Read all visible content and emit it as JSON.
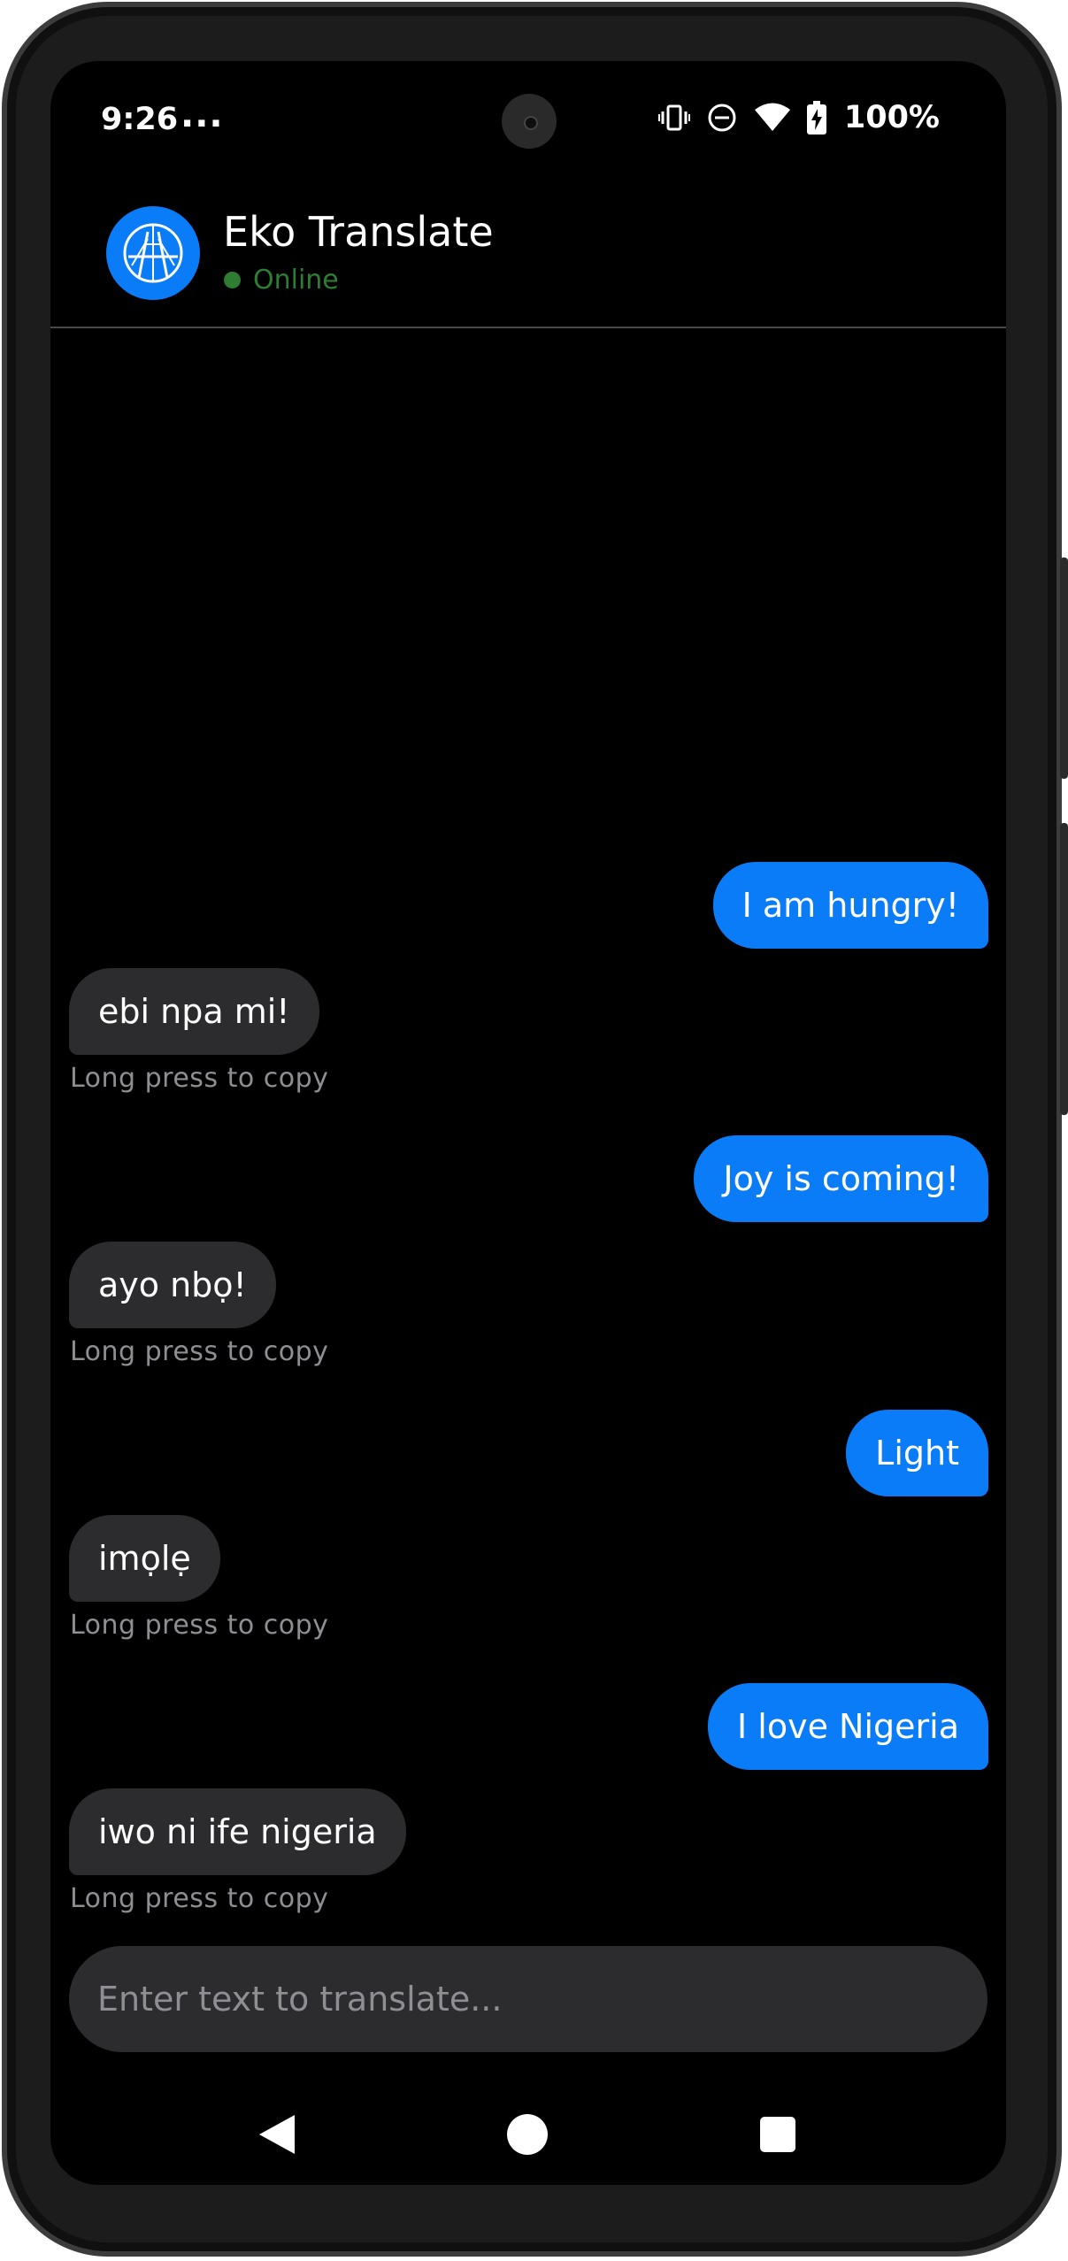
{
  "status_bar": {
    "time": "9:26",
    "overflow": "...",
    "battery": "100%",
    "icons": [
      "vibrate-icon",
      "do-not-disturb-icon",
      "wifi-icon",
      "battery-charging-icon"
    ]
  },
  "header": {
    "app_name": "Eko Translate",
    "status": "Online",
    "avatar_icon": "bridge-logo-icon",
    "accent_color": "#0a7cf7",
    "status_color": "#2e7d32"
  },
  "messages": [
    {
      "type": "sent",
      "text": "I am hungry!"
    },
    {
      "type": "received",
      "text": "ebi npa mi!",
      "hint": "Long press to copy"
    },
    {
      "type": "sent",
      "text": "Joy is coming!"
    },
    {
      "type": "received",
      "text": "ayo nbọ!",
      "hint": "Long press to copy"
    },
    {
      "type": "sent",
      "text": "Light"
    },
    {
      "type": "received",
      "text": "imọlẹ",
      "hint": "Long press to copy"
    },
    {
      "type": "sent",
      "text": "I love Nigeria"
    },
    {
      "type": "received",
      "text": "iwo ni ife nigeria",
      "hint": "Long press to copy"
    }
  ],
  "input": {
    "placeholder": "Enter text to translate...",
    "value": ""
  },
  "nav": {
    "icons": [
      "back-icon",
      "home-icon",
      "recents-icon"
    ]
  }
}
